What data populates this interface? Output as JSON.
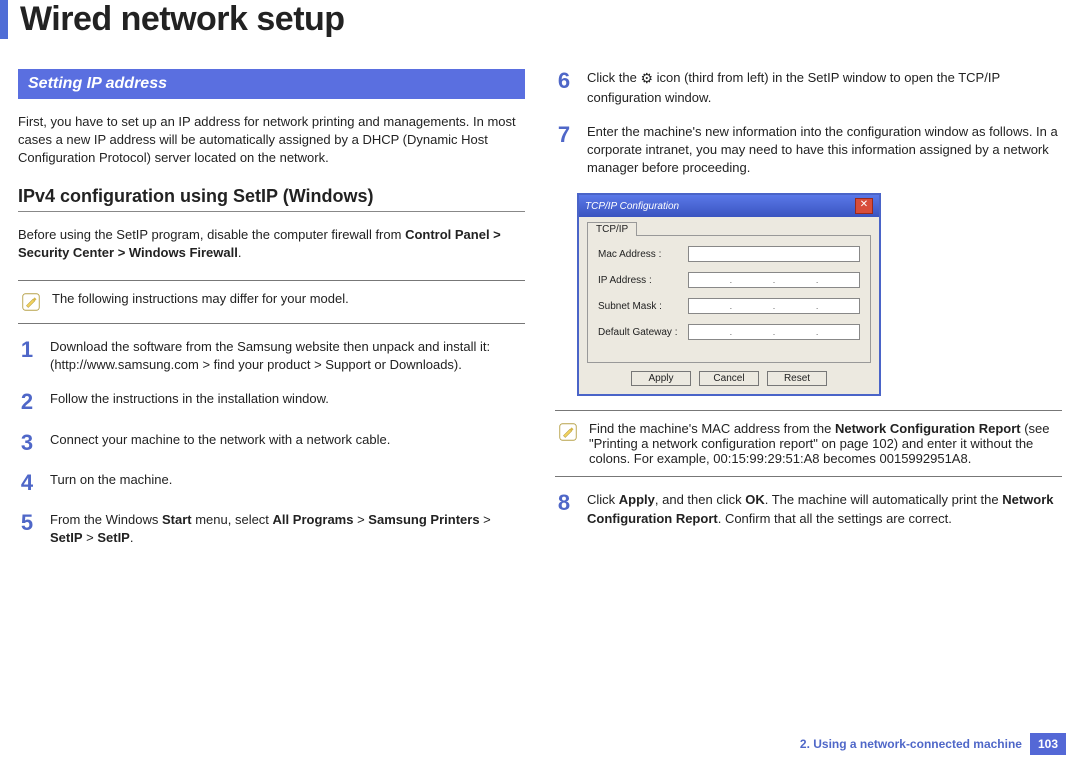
{
  "title": "Wired network setup",
  "section_head": "Setting IP address",
  "intro": "First, you have to set up an IP address for network printing and managements. In most cases a new IP address will be automatically assigned by a DHCP (Dynamic Host Configuration Protocol) server located on the network.",
  "subhead": "IPv4 configuration using SetIP (Windows)",
  "pre_note_a": "Before using the SetIP program, disable the computer firewall from ",
  "pre_note_b": "Control Panel > Security Center > Windows Firewall",
  "note1": "The following instructions may differ for your model.",
  "steps_left": {
    "s1": "Download the software from the Samsung website then unpack and install it: (http://www.samsung.com > find your product > Support or Downloads).",
    "s2": "Follow the instructions in the installation window.",
    "s3": "Connect your machine to the network with a network cable.",
    "s4": "Turn on the machine.",
    "s5a": "From the Windows ",
    "s5b": "Start",
    "s5c": " menu, select ",
    "s5d": "All Programs",
    "s5e": " > ",
    "s5f": "Samsung Printers",
    "s5g": " > ",
    "s5h": "SetIP",
    "s5i": " > ",
    "s5j": "SetIP",
    "s5k": "."
  },
  "steps_right": {
    "s6a": "Click the ",
    "s6b": " icon (third from left) in the SetIP window to open the TCP/IP configuration window.",
    "s7": "Enter the machine's new information into the configuration window as follows. In a corporate intranet, you may need to have this information assigned by a network manager before proceeding.",
    "s8a": "Click ",
    "s8b": "Apply",
    "s8c": ", and then click ",
    "s8d": "OK",
    "s8e": ". The machine will automatically print the ",
    "s8f": "Network Configuration Report",
    "s8g": ". Confirm that all the settings are correct."
  },
  "dialog": {
    "title": "TCP/IP Configuration",
    "tab": "TCP/IP",
    "mac": "Mac Address :",
    "ip": "IP Address :",
    "mask": "Subnet Mask :",
    "gw": "Default Gateway :",
    "apply": "Apply",
    "cancel": "Cancel",
    "reset": "Reset"
  },
  "note2a": "Find the machine's MAC address from the ",
  "note2b": "Network Configuration Report",
  "note2c": " (see \"Printing a network configuration report\" on page 102) and enter it without the colons. For example, 00:15:99:29:51:A8 becomes 0015992951A8.",
  "footer": {
    "chapter_num": "2.",
    "chapter_text": "  Using a network-connected machine",
    "page": "103"
  }
}
